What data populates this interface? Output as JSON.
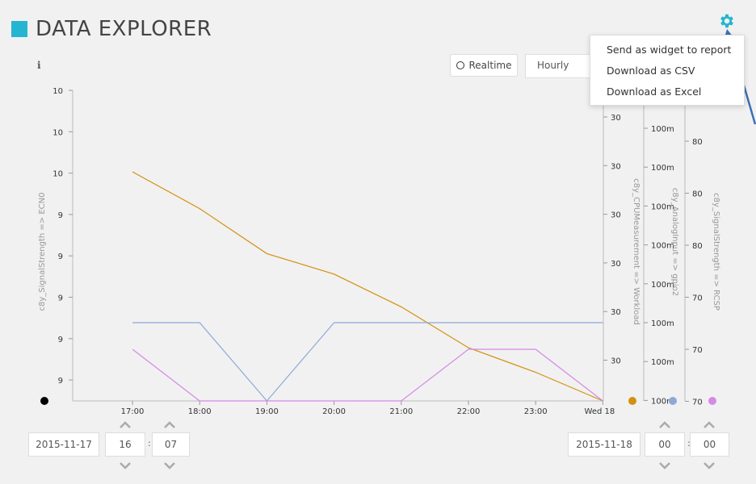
{
  "header": {
    "title": "DATA EXPLORER",
    "accent_color": "#26b5d1",
    "settings_icon": "gear-icon",
    "info_icon": "i"
  },
  "toolbar": {
    "realtime_label": "Realtime",
    "interval_value": "Hourly"
  },
  "menu": {
    "items": [
      "Send as widget to report",
      "Download as CSV",
      "Download as Excel"
    ]
  },
  "chart_data": {
    "type": "line",
    "x": [
      "17:00",
      "18:00",
      "19:00",
      "20:00",
      "21:00",
      "22:00",
      "23:00",
      "Wed 18"
    ],
    "axes": [
      {
        "id": "ecn0",
        "label": "c8y_SignalStrength => ECN0",
        "position": "left",
        "ticks": [
          "10",
          "10",
          "10",
          "9",
          "9",
          "9",
          "9",
          "9"
        ],
        "color": "#000000"
      },
      {
        "id": "workload",
        "label": "c8y_CPUMeasurement => Workload",
        "position": "right",
        "ticks": [
          "30",
          "30",
          "30",
          "30",
          "30",
          "30"
        ],
        "color": "#d4900f"
      },
      {
        "id": "gpio2",
        "label": "c8y_AnalogInput => gpio2",
        "position": "right",
        "ticks": [
          "100m",
          "100m",
          "100m",
          "100m",
          "100m",
          "100m",
          "100m",
          "100m"
        ],
        "color": "#8fa8d8"
      },
      {
        "id": "rcsp",
        "label": "c8y_SignalStrength => RCSP",
        "position": "right",
        "ticks": [
          "80",
          "80",
          "80",
          "70",
          "70",
          "70",
          "70"
        ],
        "color": "#d58ae6"
      }
    ],
    "series": [
      {
        "axis": "workload",
        "color": "#d4900f",
        "values": [
          34.2,
          33.3,
          32.2,
          31.7,
          30.9,
          29.9,
          29.3,
          28.6
        ]
      },
      {
        "axis": "gpio2",
        "color": "#8fa8d8",
        "values": [
          0.1,
          0.1,
          0.0,
          0.1,
          0.1,
          0.1,
          0.1,
          0.1
        ]
      },
      {
        "axis": "rcsp",
        "color": "#d58ae6",
        "values": [
          72.5,
          70.0,
          70.0,
          70.0,
          70.0,
          72.5,
          72.5,
          70.0
        ]
      }
    ]
  },
  "range": {
    "start_date": "2015-11-17",
    "start_hour": "16",
    "start_minute": "07",
    "end_date": "2015-11-18",
    "end_hour": "00",
    "end_minute": "00",
    "separator": ":"
  }
}
